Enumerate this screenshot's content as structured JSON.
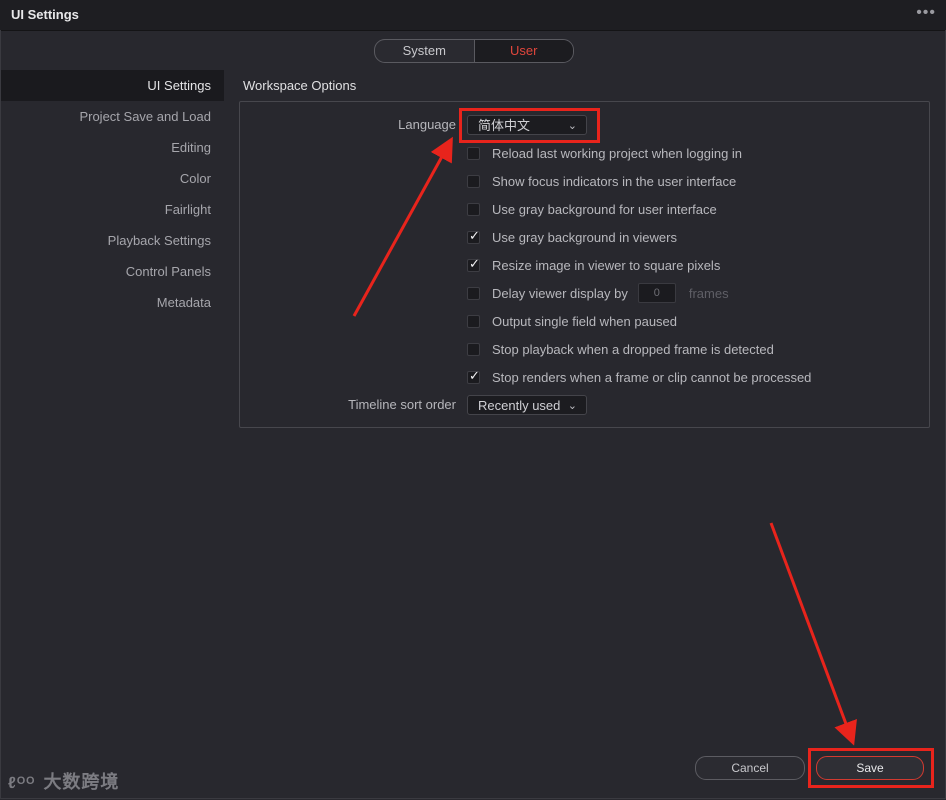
{
  "window": {
    "title": "UI Settings",
    "menu_icon": "more-icon"
  },
  "toggle": {
    "system": "System",
    "user": "User"
  },
  "sidebar": {
    "items": [
      {
        "label": "UI Settings"
      },
      {
        "label": "Project Save and Load"
      },
      {
        "label": "Editing"
      },
      {
        "label": "Color"
      },
      {
        "label": "Fairlight"
      },
      {
        "label": "Playback Settings"
      },
      {
        "label": "Control Panels"
      },
      {
        "label": "Metadata"
      }
    ]
  },
  "workspace": {
    "title": "Workspace Options",
    "language_label": "Language",
    "language_value": "简体中文",
    "options": [
      {
        "label": "Reload last working project when logging in",
        "checked": false
      },
      {
        "label": "Show focus indicators in the user interface",
        "checked": false
      },
      {
        "label": "Use gray background for user interface",
        "checked": false
      },
      {
        "label": "Use gray background in viewers",
        "checked": true
      },
      {
        "label": "Resize image in viewer to square pixels",
        "checked": true
      },
      {
        "label": "Delay viewer display by",
        "checked": false,
        "input_value": "0",
        "suffix": "frames"
      },
      {
        "label": "Output single field when paused",
        "checked": false
      },
      {
        "label": "Stop playback when a dropped frame is detected",
        "checked": false
      },
      {
        "label": "Stop renders when a frame or clip cannot be processed",
        "checked": true
      }
    ],
    "sort_label": "Timeline sort order",
    "sort_value": "Recently used"
  },
  "buttons": {
    "cancel": "Cancel",
    "save": "Save"
  },
  "watermark": {
    "logo": "ℓᴼᴼ",
    "text": "大数跨境"
  },
  "colors": {
    "accent": "#e0463c",
    "annotation": "#e8241c"
  }
}
